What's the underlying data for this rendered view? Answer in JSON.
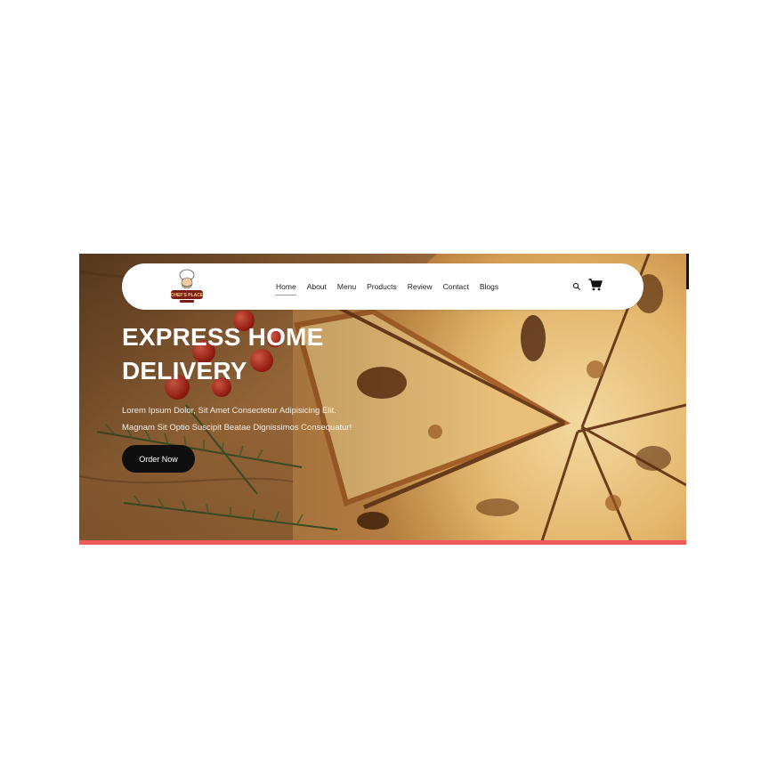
{
  "nav": {
    "logo_icon": "chef-logo-icon",
    "logo_text": "CHEF'S PLACE",
    "items": [
      {
        "label": "Home",
        "active": true
      },
      {
        "label": "About"
      },
      {
        "label": "Menu"
      },
      {
        "label": "Products"
      },
      {
        "label": "Review"
      },
      {
        "label": "Contact"
      },
      {
        "label": "Blogs"
      }
    ],
    "search_icon": "search-icon",
    "cart_icon": "cart-icon"
  },
  "hero": {
    "title_line1": "EXPRESS HOME",
    "title_line2": "DELIVERY",
    "subtitle_line1": "Lorem Ipsum Dolor, Sit Amet Consectetur Adipisicing Elit.",
    "subtitle_line2": "Magnam Sit Optio Suscipit Beatae Dignissimos Consequatur!",
    "cta_label": "Order Now",
    "background": "pizza-photo"
  },
  "colors": {
    "accent_bar": "#f05a5a",
    "button_bg": "#0e0e0e",
    "nav_bg": "#ffffff"
  }
}
